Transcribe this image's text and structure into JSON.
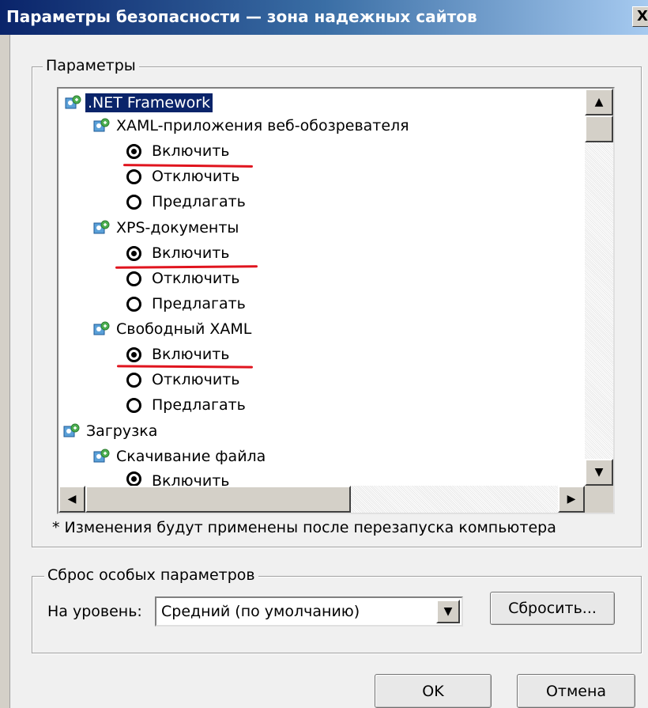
{
  "window": {
    "title": "Параметры безопасности — зона надежных сайтов",
    "close_label": "X"
  },
  "settings_group": {
    "legend": "Параметры",
    "tree": [
      {
        "kind": "group",
        "label": ".NET Framework",
        "selected": true
      },
      {
        "kind": "group",
        "label": "XAML-приложения веб-обозревателя"
      },
      {
        "kind": "option",
        "label": "Включить",
        "checked": true,
        "underlined": true
      },
      {
        "kind": "option",
        "label": "Отключить",
        "checked": false
      },
      {
        "kind": "option",
        "label": "Предлагать",
        "checked": false
      },
      {
        "kind": "group",
        "label": "XPS-документы"
      },
      {
        "kind": "option",
        "label": "Включить",
        "checked": true,
        "underlined": true
      },
      {
        "kind": "option",
        "label": "Отключить",
        "checked": false
      },
      {
        "kind": "option",
        "label": "Предлагать",
        "checked": false
      },
      {
        "kind": "group",
        "label": "Свободный XAML"
      },
      {
        "kind": "option",
        "label": "Включить",
        "checked": true,
        "underlined": true
      },
      {
        "kind": "option",
        "label": "Отключить",
        "checked": false
      },
      {
        "kind": "option",
        "label": "Предлагать",
        "checked": false
      },
      {
        "kind": "group",
        "label": "Загрузка"
      },
      {
        "kind": "group",
        "label": "Скачивание файла"
      },
      {
        "kind": "option",
        "label": "Включить",
        "checked": true
      }
    ],
    "note": "* Изменения будут применены после перезапуска компьютера"
  },
  "reset_group": {
    "legend": "Сброс особых параметров",
    "level_label": "На уровень:",
    "level_value": "Средний (по умолчанию)",
    "reset_button": "Сбросить..."
  },
  "footer": {
    "ok_label": "OK",
    "cancel_label": "Отмена"
  },
  "colors": {
    "selection": "#0a246a",
    "annotation_underline": "#e0141e"
  }
}
